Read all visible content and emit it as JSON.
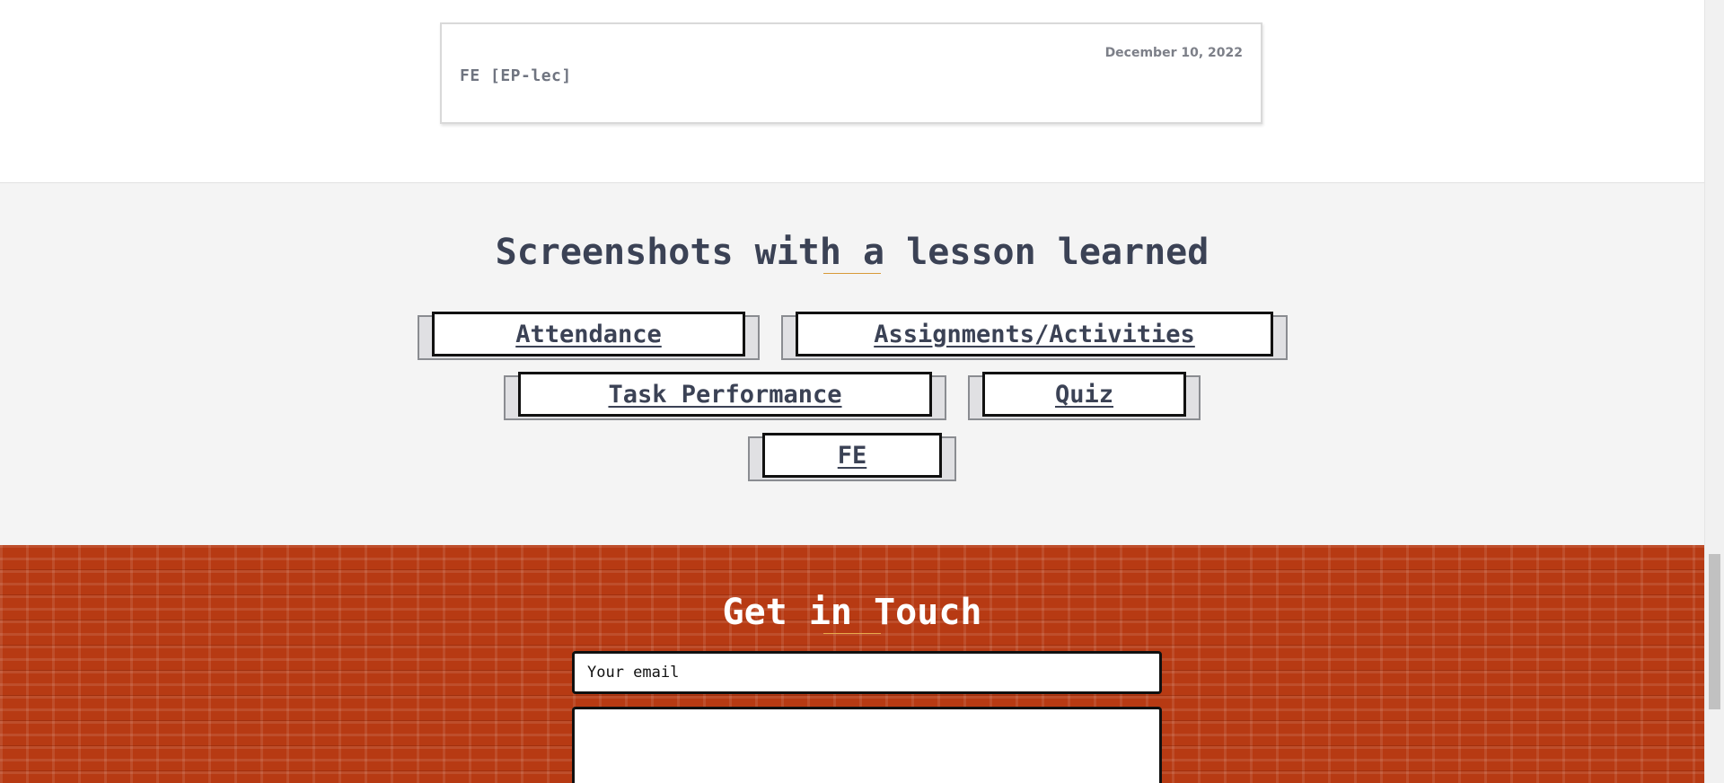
{
  "post_card": {
    "date": "December 10, 2022",
    "title": "FE [EP-lec]"
  },
  "screenshots_section": {
    "title": "Screenshots with a lesson learned",
    "buttons": [
      "Attendance",
      "Assignments/Activities",
      "Task Performance",
      "Quiz",
      "FE"
    ]
  },
  "contact_section": {
    "title": "Get in Touch",
    "email_placeholder": "Your email",
    "message_value": ""
  },
  "colors": {
    "heading": "#3b4255",
    "accent_underline": "#d89a38",
    "brick_red": "#b73a13",
    "section_gray": "#f4f4f4"
  },
  "icons": {
    "scrollbar": "vertical-scrollbar"
  }
}
